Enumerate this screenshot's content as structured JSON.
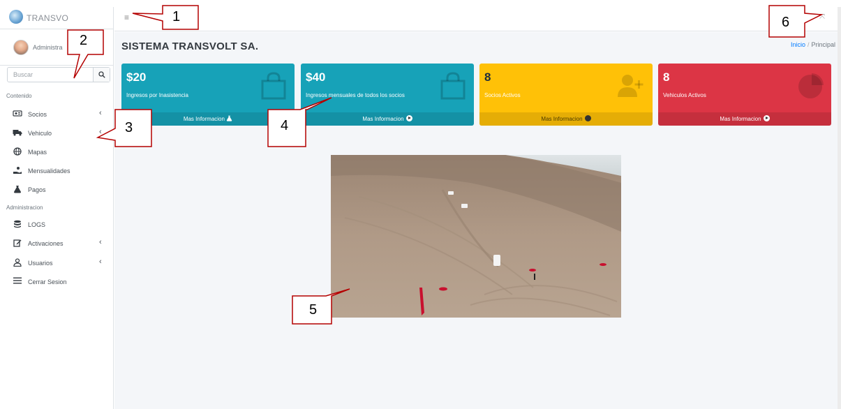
{
  "brand": {
    "text": "TRANSVO"
  },
  "user": {
    "name": "Administra"
  },
  "search": {
    "placeholder": "Buscar"
  },
  "sidebar": {
    "section1": "Contenido",
    "section2": "Administracion",
    "items": [
      {
        "label": "Socios",
        "icon": "users-icon",
        "chevron": "‹"
      },
      {
        "label": "Vehiculo",
        "icon": "truck-icon",
        "chevron": "‹"
      },
      {
        "label": "Mapas",
        "icon": "globe-icon"
      },
      {
        "label": "Mensualidades",
        "icon": "hand-coin-icon"
      },
      {
        "label": "Pagos",
        "icon": "money-bag-icon"
      },
      {
        "label": "LOGS",
        "icon": "database-icon"
      },
      {
        "label": "Activaciones",
        "icon": "edit-icon",
        "chevron": "‹"
      },
      {
        "label": "Usuarios",
        "icon": "user-icon",
        "chevron": "‹"
      },
      {
        "label": "Cerrar Sesion",
        "icon": "menu-lines-icon"
      }
    ]
  },
  "topbar": {
    "menu_glyph": "≡",
    "fullscreen_glyph": "⤧"
  },
  "main": {
    "title": "SISTEMA TRANSVOLT SA.",
    "breadcrumb": {
      "home": "Inicio",
      "sep": "/",
      "current": "Principal"
    },
    "cards": [
      {
        "value": "$20",
        "label": "Ingresos por Inasistencia",
        "footer": "Mas Informacion",
        "color": "#17a2b8"
      },
      {
        "value": "$40",
        "label": "Ingresos mensuales de todos los socios",
        "footer": "Mas Informacion",
        "color": "#17a2b8"
      },
      {
        "value": "8",
        "label": "Socios Activos",
        "footer": "Mas Informacion",
        "color": "#ffc107"
      },
      {
        "value": "8",
        "label": "Vehiculos Activos",
        "footer": "Mas Informacion",
        "color": "#dc3545"
      }
    ]
  },
  "annotations": [
    "1",
    "2",
    "3",
    "4",
    "5",
    "6"
  ],
  "colors": {
    "annotation_border": "#b40000",
    "sidebar_border": "#dee2e6",
    "main_bg": "#f4f6f9"
  }
}
